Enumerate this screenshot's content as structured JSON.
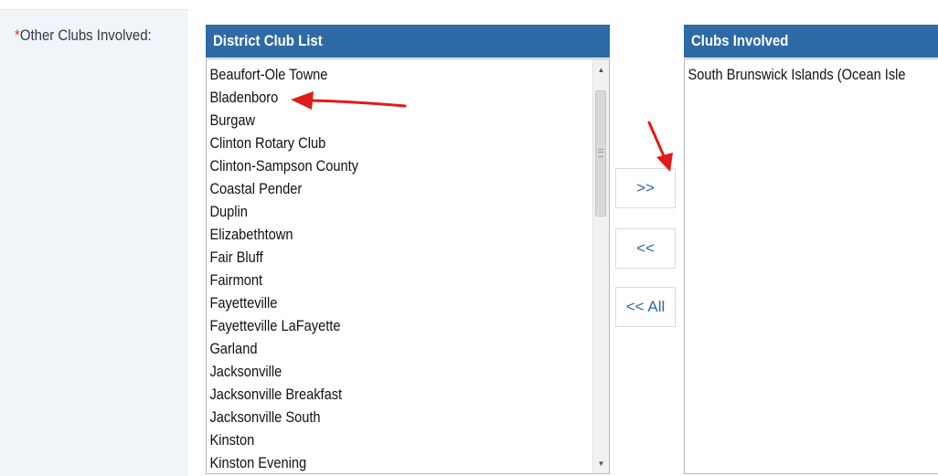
{
  "field": {
    "required_marker": "*",
    "label": "Other Clubs Involved:"
  },
  "district_list": {
    "header": "District Club List",
    "items": [
      "Beaufort-Ole Towne",
      "Bladenboro",
      "Burgaw",
      "Clinton Rotary Club",
      "Clinton-Sampson County",
      "Coastal Pender",
      "Duplin",
      "Elizabethtown",
      "Fair Bluff",
      "Fairmont",
      "Fayetteville",
      "Fayetteville LaFayette",
      "Garland",
      "Jacksonville",
      "Jacksonville Breakfast",
      "Jacksonville South",
      "Kinston",
      "Kinston Evening"
    ]
  },
  "buttons": {
    "add": ">>",
    "remove": "<<",
    "remove_all": "<< All"
  },
  "involved_list": {
    "header": "Clubs Involved",
    "items": [
      "South Brunswick Islands (Ocean Isle"
    ]
  },
  "colors": {
    "header_bg": "#2e6aa6",
    "label_bg": "#f1f4f8",
    "required": "#d13a3a",
    "annotation_arrow": "#e01b1b"
  },
  "icons": {
    "scroll_up": "triangle-up",
    "scroll_down": "triangle-down"
  }
}
